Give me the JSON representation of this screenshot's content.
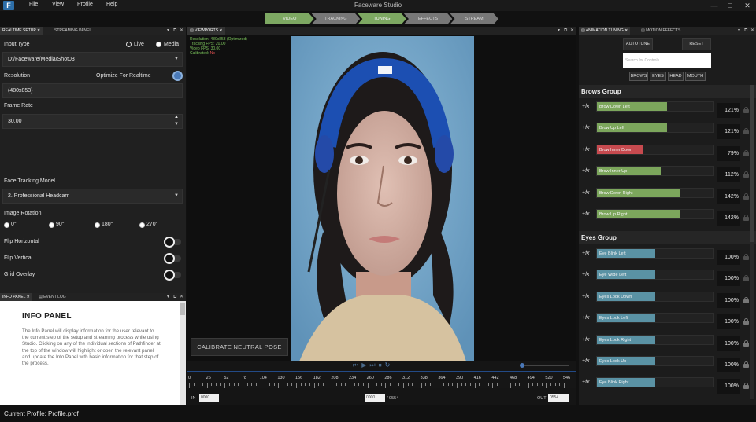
{
  "app": {
    "title": "Faceware Studio",
    "logo_glyph": "F",
    "menu": [
      "File",
      "View",
      "Profile",
      "Help"
    ],
    "window_controls": [
      "—",
      "□",
      "✕"
    ]
  },
  "pathfinder": {
    "steps": [
      {
        "label": "VIDEO",
        "active": true
      },
      {
        "label": "TRACKING",
        "active": false
      },
      {
        "label": "TUNING",
        "active": true
      },
      {
        "label": "EFFECTS",
        "active": false
      },
      {
        "label": "STREAM",
        "active": false
      }
    ]
  },
  "left_panel": {
    "tabs": [
      "REALTIME SETUP",
      "STREAMING PANEL"
    ],
    "input_type_label": "Input Type",
    "input_live": "Live",
    "input_media": "Media",
    "input_path": "D:/Faceware/Media/Shot03",
    "resolution_label": "Resolution",
    "optimize_label": "Optimize For Realtime",
    "resolution_value": "(480x853)",
    "frame_rate_label": "Frame Rate",
    "frame_rate_value": "30.00",
    "face_model_label": "Face Tracking Model",
    "face_model_value": "2. Professional Headcam",
    "rotation_label": "Image Rotation",
    "rotations": [
      "0°",
      "90°",
      "180°",
      "270°"
    ],
    "flip_h_label": "Flip Horizontal",
    "flip_v_label": "Flip Vertical",
    "grid_label": "Grid Overlay"
  },
  "info_panel": {
    "tabs": [
      "INFO PANEL",
      "EVENT LOG"
    ],
    "title": "INFO PANEL",
    "text": "The Info Panel will display information for the user relevant to the current step of the setup and streaming process while using Studio. Clicking on any of the individual sections of Pathfinder at the top of the window will highlight or open the relevant panel and update the Info Panel with basic information for that step of the process."
  },
  "viewport": {
    "tab": "VIEWPORTS",
    "info_lines": [
      "Resolution: 480x853 (Optimized)",
      "Tracking FPS: 20.00",
      "Video FPS: 30.00"
    ],
    "calibrated_label": "Calibrated:",
    "calibrated_value": "No",
    "calibrate_button": "CALIBRATE NEUTRAL POSE"
  },
  "timeline": {
    "ticks": [
      "0",
      "26",
      "52",
      "78",
      "104",
      "130",
      "156",
      "182",
      "208",
      "234",
      "260",
      "286",
      "312",
      "338",
      "364",
      "390",
      "416",
      "442",
      "468",
      "494",
      "520",
      "546"
    ],
    "in_label": "IN",
    "in_value": "0000",
    "current_value": "0000",
    "total": "/ 0554",
    "out_label": "OUT",
    "out_value": "0554"
  },
  "right_panel": {
    "tabs": [
      "ANIMATION TUNING",
      "MOTION EFFECTS"
    ],
    "autotune": "AUTOTUNE",
    "reset": "RESET",
    "search_placeholder": "Search for Controls",
    "group_buttons": [
      "BROWS",
      "EYES",
      "HEAD",
      "MOUTH"
    ],
    "fx_label": "+fx",
    "brows_group": "Brows Group",
    "eyes_group": "Eyes Group",
    "brows": [
      {
        "label": "Brow Down Left",
        "pct": "121%",
        "fill": 0.6,
        "color": "#7ca65c"
      },
      {
        "label": "Brow Up Left",
        "pct": "121%",
        "fill": 0.6,
        "color": "#7ca65c"
      },
      {
        "label": "Brow Inner Down",
        "pct": "79%",
        "fill": 0.39,
        "color": "#c74a4f"
      },
      {
        "label": "Brow Inner Up",
        "pct": "112%",
        "fill": 0.55,
        "color": "#7ca65c"
      },
      {
        "label": "Brow Down Right",
        "pct": "142%",
        "fill": 0.71,
        "color": "#7ca65c"
      },
      {
        "label": "Brow Up Right",
        "pct": "142%",
        "fill": 0.71,
        "color": "#7ca65c"
      }
    ],
    "eyes": [
      {
        "label": "Eye Blink Left",
        "pct": "100%",
        "fill": 0.5,
        "color": "#5a92a4"
      },
      {
        "label": "Eye Wide Left",
        "pct": "100%",
        "fill": 0.5,
        "color": "#5a92a4"
      },
      {
        "label": "Eyes Look Down",
        "pct": "100%",
        "fill": 0.5,
        "color": "#5a92a4"
      },
      {
        "label": "Eyes Look Left",
        "pct": "100%",
        "fill": 0.5,
        "color": "#5a92a4"
      },
      {
        "label": "Eyes Look Right",
        "pct": "100%",
        "fill": 0.5,
        "color": "#5a92a4"
      },
      {
        "label": "Eyes Look Up",
        "pct": "100%",
        "fill": 0.5,
        "color": "#5a92a4"
      },
      {
        "label": "Eye Blink Right",
        "pct": "100%",
        "fill": 0.5,
        "color": "#5a92a4"
      }
    ]
  },
  "status": {
    "profile": "Current Profile: Profile.prof"
  }
}
